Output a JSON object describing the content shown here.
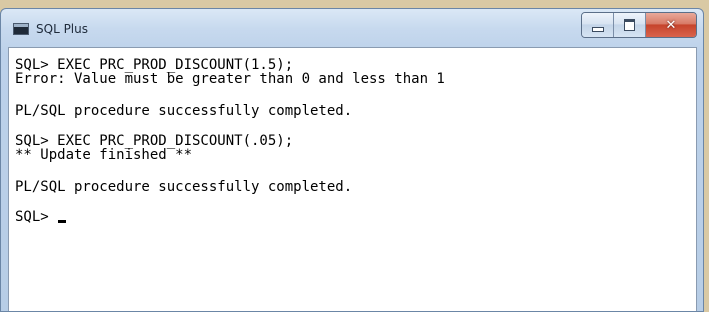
{
  "window": {
    "title": "SQL Plus",
    "app_icon": "console-window-icon",
    "controls": {
      "minimize": "minimize-icon",
      "maximize": "maximize-icon",
      "close": "close-icon"
    }
  },
  "console": {
    "lines": [
      "SQL> EXEC PRC_PROD_DISCOUNT(1.5);",
      "Error: Value must be greater than 0 and less than 1",
      "PL/SQL procedure successfully completed.",
      "SQL> EXEC PRC_PROD_DISCOUNT(.05);",
      "** Update finished **",
      "PL/SQL procedure successfully completed."
    ],
    "prompt": "SQL> "
  },
  "colors": {
    "titlebar": "#c7d9ee",
    "close_button": "#c6442c",
    "console_background": "#ffffff",
    "console_text": "#000000"
  }
}
